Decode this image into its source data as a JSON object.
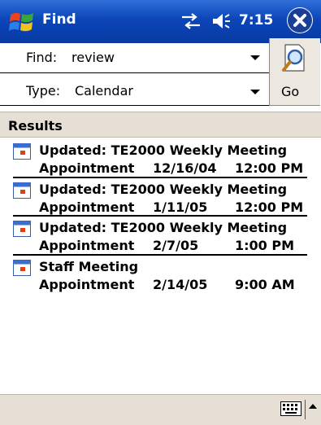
{
  "titlebar": {
    "app_title": "Find",
    "clock": "7:15",
    "icons": [
      "windows-start-icon",
      "connectivity-icon",
      "volume-icon",
      "close-icon"
    ]
  },
  "search": {
    "find_label": "Find:",
    "find_value": "review",
    "type_label": "Type:",
    "type_value": "Calendar",
    "go_label": "Go"
  },
  "results": {
    "header": "Results",
    "items": [
      {
        "title": "Updated: TE2000 Weekly Meeting",
        "type": "Appointment",
        "date": "12/16/04",
        "time": "12:00 PM"
      },
      {
        "title": "Updated: TE2000 Weekly Meeting",
        "type": "Appointment",
        "date": "1/11/05",
        "time": "12:00 PM"
      },
      {
        "title": "Updated: TE2000 Weekly Meeting",
        "type": "Appointment",
        "date": "2/7/05",
        "time": "1:00 PM"
      },
      {
        "title": "Staff Meeting",
        "type": "Appointment",
        "date": "2/14/05",
        "time": "9:00 AM"
      }
    ]
  },
  "colors": {
    "titlebar": "#0b45b8",
    "header_bg": "#e6dfd6"
  }
}
